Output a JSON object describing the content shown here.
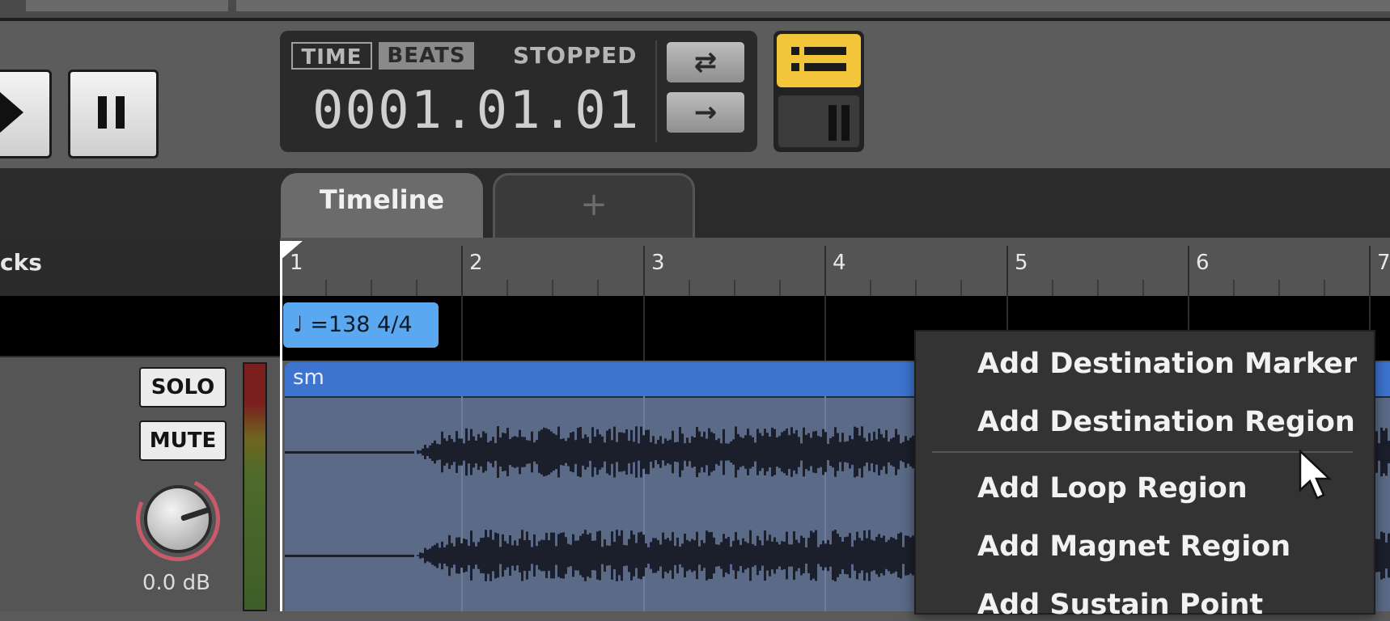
{
  "transport": {
    "time_mode_label": "TIME",
    "beats_mode_label": "BEATS",
    "status": "STOPPED",
    "position": "0001.01.01",
    "loop_icon": "⇄",
    "arrow_icon": "→"
  },
  "tabs": [
    {
      "label": "Timeline"
    },
    {
      "label": "+"
    }
  ],
  "left_panel": {
    "tracks_label": "cks",
    "solo_label": "SOLO",
    "mute_label": "MUTE",
    "gain": "0.0 dB"
  },
  "ruler": {
    "bars": [
      "1",
      "2",
      "3",
      "4",
      "5",
      "6",
      "7"
    ]
  },
  "tempo_marker": {
    "label": "♩ =138 4/4"
  },
  "clip": {
    "name": "sm",
    "color": "#3d74cf"
  },
  "context_menu": {
    "items": [
      "Add Destination Marker",
      "Add Destination Region",
      "Add Loop Region",
      "Add Magnet Region",
      "Add Sustain Point"
    ]
  },
  "colors": {
    "accent_yellow": "#f2c53a",
    "tempo_blue": "#5aa9f0",
    "background": "#5a5a5a"
  }
}
